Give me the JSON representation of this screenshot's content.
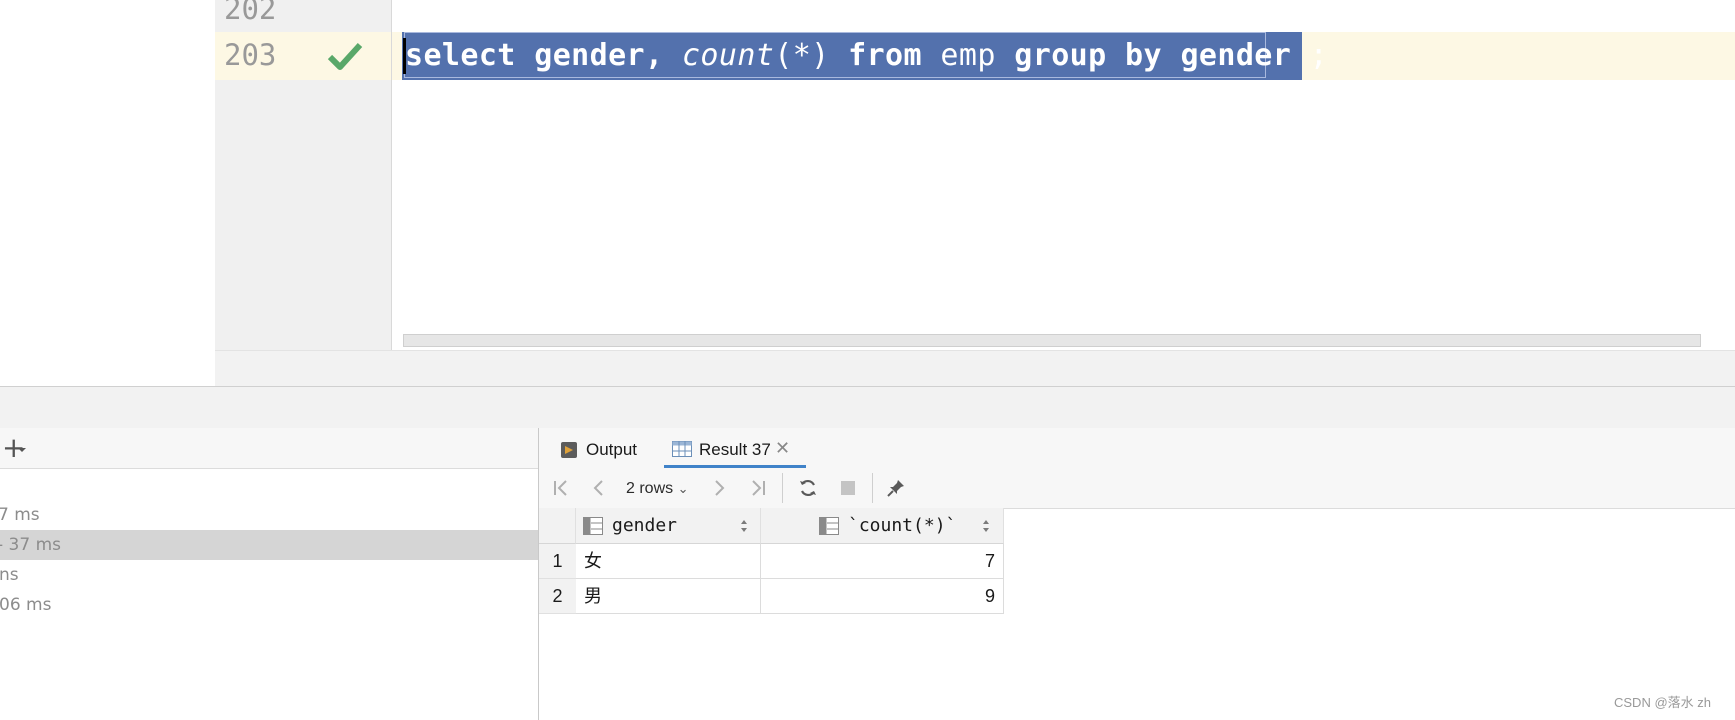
{
  "editor": {
    "line_202": "202",
    "line_203": "203",
    "code": {
      "t1": "select gender, ",
      "t2": "count",
      "t3": "(*) ",
      "t4": "from",
      "t5": " emp ",
      "t6": "group by",
      "t7": " gender",
      "t8": " ;"
    }
  },
  "services": {
    "items": [
      {
        "label": "7 ms"
      },
      {
        "label": "- 37 ms"
      },
      {
        "label": "ns"
      },
      {
        "label": "06 ms"
      }
    ]
  },
  "results": {
    "tabs": [
      {
        "label": "Output"
      },
      {
        "label": "Result 37"
      }
    ],
    "rows_label": "2 rows",
    "columns": [
      "gender",
      "`count(*)`"
    ],
    "rows": [
      {
        "num": "1",
        "gender": "女",
        "count": "7"
      },
      {
        "num": "2",
        "gender": "男",
        "count": "9"
      }
    ]
  },
  "watermark": "CSDN @落水 zh",
  "colors": {
    "selection": "#5371ad",
    "current_line": "#fdf8e4",
    "check_green": "#59a869",
    "tab_accent": "#4083c9"
  },
  "icons": [
    "check-icon",
    "add-icon",
    "output-icon",
    "result-table-icon",
    "close-icon",
    "first-page-icon",
    "prev-page-icon",
    "next-page-icon",
    "last-page-icon",
    "refresh-icon",
    "stop-icon",
    "pin-icon",
    "column-icon",
    "sort-icon"
  ]
}
